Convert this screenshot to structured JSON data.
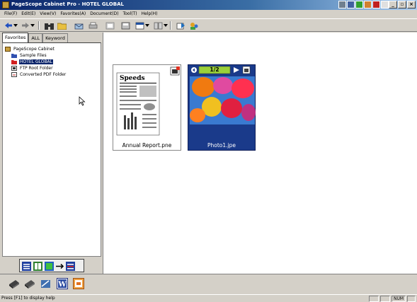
{
  "window": {
    "title": "PageScope Cabinet Pro - HOTEL GLOBAL"
  },
  "menubar": {
    "items": [
      "File(F)",
      "Edit(E)",
      "View(V)",
      "Favorites(A)",
      "Document(D)",
      "Tool(T)",
      "Help(H)"
    ]
  },
  "toolbar": {
    "buttons": [
      "back-icon",
      "forward-icon",
      "binoculars-icon",
      "folder-icon",
      "mail-icon",
      "print-icon",
      "scan-icon",
      "save-icon",
      "view-icon",
      "layout-icon",
      "export-icon",
      "user-icon"
    ]
  },
  "left_panel": {
    "tabs": [
      "Favorites",
      "ALL",
      "Keyword"
    ],
    "active_tab": "Favorites",
    "tree": [
      {
        "label": "PageScope Cabinet",
        "icon": "cabinet-icon",
        "selected": false
      },
      {
        "label": "Sample Files",
        "icon": "folder-blue-icon",
        "selected": false
      },
      {
        "label": "HOTEL GLOBAL",
        "icon": "folder-red-icon",
        "selected": true
      },
      {
        "label": "FTP Root Folder",
        "icon": "ftp-folder-icon",
        "selected": false
      },
      {
        "label": "Converted PDF Folder",
        "icon": "pdf-folder-icon",
        "selected": false
      }
    ]
  },
  "documents": [
    {
      "name": "Annual Report.pne",
      "type": "document",
      "newspaper_title": "Speeds"
    },
    {
      "name": "Photo1.jpe",
      "type": "image",
      "page": "1/2"
    }
  ],
  "statusbar": {
    "text": "Press [F1] to display help",
    "indicator": "NUM"
  },
  "colors": {
    "titlebar": "#0a246a",
    "selection": "#0a246a",
    "photo_bg": "#1a3a8a",
    "page_badge": "#9ad03a"
  }
}
